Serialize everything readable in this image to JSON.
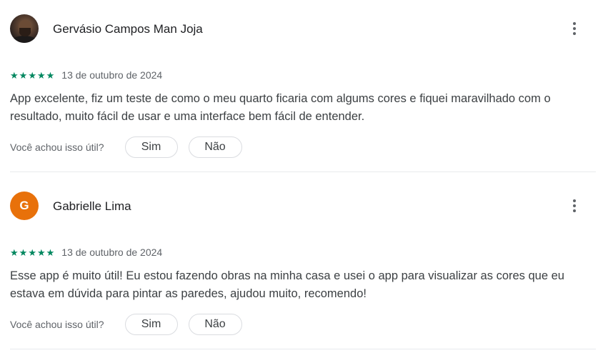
{
  "reviews": [
    {
      "author": "Gervásio Campos Man Joja",
      "avatar_type": "photo",
      "rating": 5,
      "date": "13 de outubro de 2024",
      "text": "App excelente, fiz um teste de como o meu quarto ficaria com algums cores e fiquei maravilhado com o resultado, muito fácil de usar e uma interface bem fácil de entender.",
      "helpful_prompt": "Você achou isso útil?",
      "yes_label": "Sim",
      "no_label": "Não"
    },
    {
      "author": "Gabrielle Lima",
      "avatar_type": "letter",
      "avatar_letter": "G",
      "avatar_color": "#e8710a",
      "rating": 5,
      "date": "13 de outubro de 2024",
      "text": "Esse app é muito útil! Eu estou fazendo obras na minha casa e usei o app para visualizar as cores que eu estava em dúvida para pintar as paredes, ajudou muito, recomendo!",
      "helpful_prompt": "Você achou isso útil?",
      "yes_label": "Sim",
      "no_label": "Não"
    }
  ],
  "icons": {
    "star": "★",
    "more": "more-vert-icon"
  },
  "colors": {
    "star": "#01875f",
    "secondary_text": "#5f6368",
    "divider": "#e8eaed"
  }
}
